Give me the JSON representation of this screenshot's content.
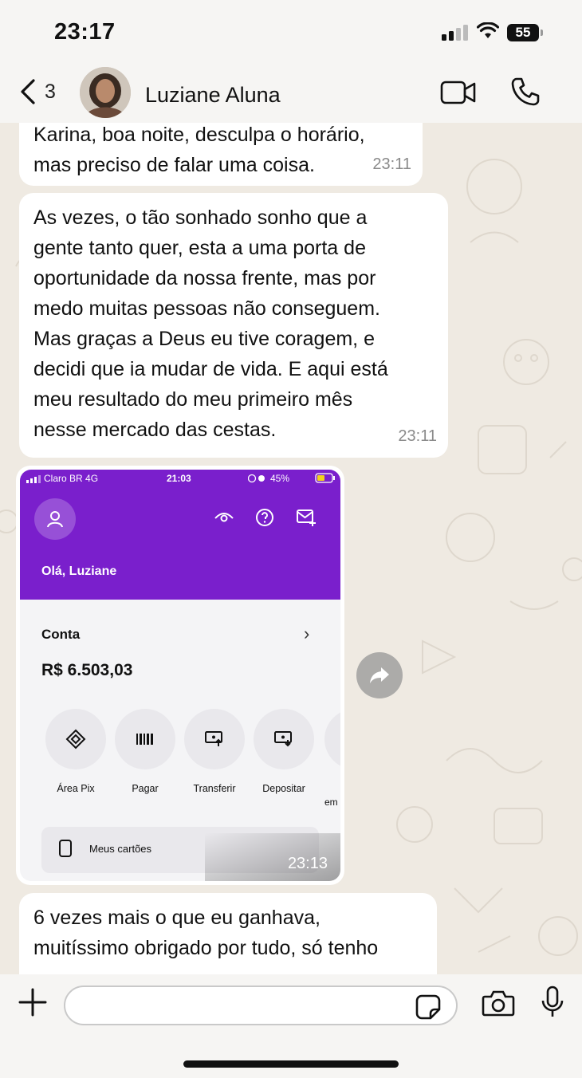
{
  "status_bar": {
    "time": "23:17",
    "battery": "55",
    "icons": [
      "signal-icon",
      "wifi-icon",
      "battery-icon"
    ]
  },
  "header": {
    "back_count": "3",
    "contact_name": "Luziane Aluna",
    "icons": [
      "back-chevron-icon",
      "video-call-icon",
      "phone-call-icon"
    ]
  },
  "messages": [
    {
      "text": "Karina, boa noite, desculpa o horário, mas preciso de falar uma coisa.",
      "lines": [
        "Karina, boa noite, desculpa o horário,",
        "mas preciso de falar uma coisa."
      ],
      "time": "23:11"
    },
    {
      "text": "As vezes, o tão sonhado sonho que a gente tanto quer, esta a uma porta de oportunidade da nossa frente, mas por medo muitas pessoas não conseguem. Mas graças a Deus eu tive coragem, e decidi que ia mudar de vida. E aqui está meu resultado do meu primeiro mês nesse mercado das cestas.",
      "lines": [
        "As vezes, o tão sonhado sonho que a",
        "gente tanto quer, esta a uma porta de",
        "oportunidade da nossa frente, mas por",
        "medo muitas pessoas não conseguem.",
        "Mas graças a Deus eu tive coragem, e",
        "decidi que ia mudar de vida. E aqui está",
        "meu resultado do meu primeiro mês",
        "nesse mercado das cestas."
      ],
      "time": "23:11"
    },
    {
      "lines": [
        "6 vezes mais o que eu ganhava,",
        "muitíssimo obrigado por tudo, só tenho"
      ]
    }
  ],
  "image_message": {
    "time": "23:13",
    "screenshot": {
      "carrier": "Claro BR  4G",
      "clock": "21:03",
      "battery": "45%",
      "greeting": "Olá, Luziane",
      "account_label": "Conta",
      "balance": "R$ 6.503,03",
      "actions": [
        {
          "label": "Área Pix",
          "icon": "pix-icon"
        },
        {
          "label": "Pagar",
          "icon": "barcode-icon"
        },
        {
          "label": "Transferir",
          "icon": "transfer-icon"
        },
        {
          "label": "Depositar",
          "icon": "deposit-icon"
        }
      ],
      "overflow_label": "em",
      "cards_label": "Meus cartões",
      "accent": "#7a1fcc"
    }
  },
  "composer": {
    "placeholder": ""
  },
  "colors": {
    "chat_bg": "#efeae2",
    "bubble": "#ffffff",
    "meta": "#8a8a8a"
  }
}
